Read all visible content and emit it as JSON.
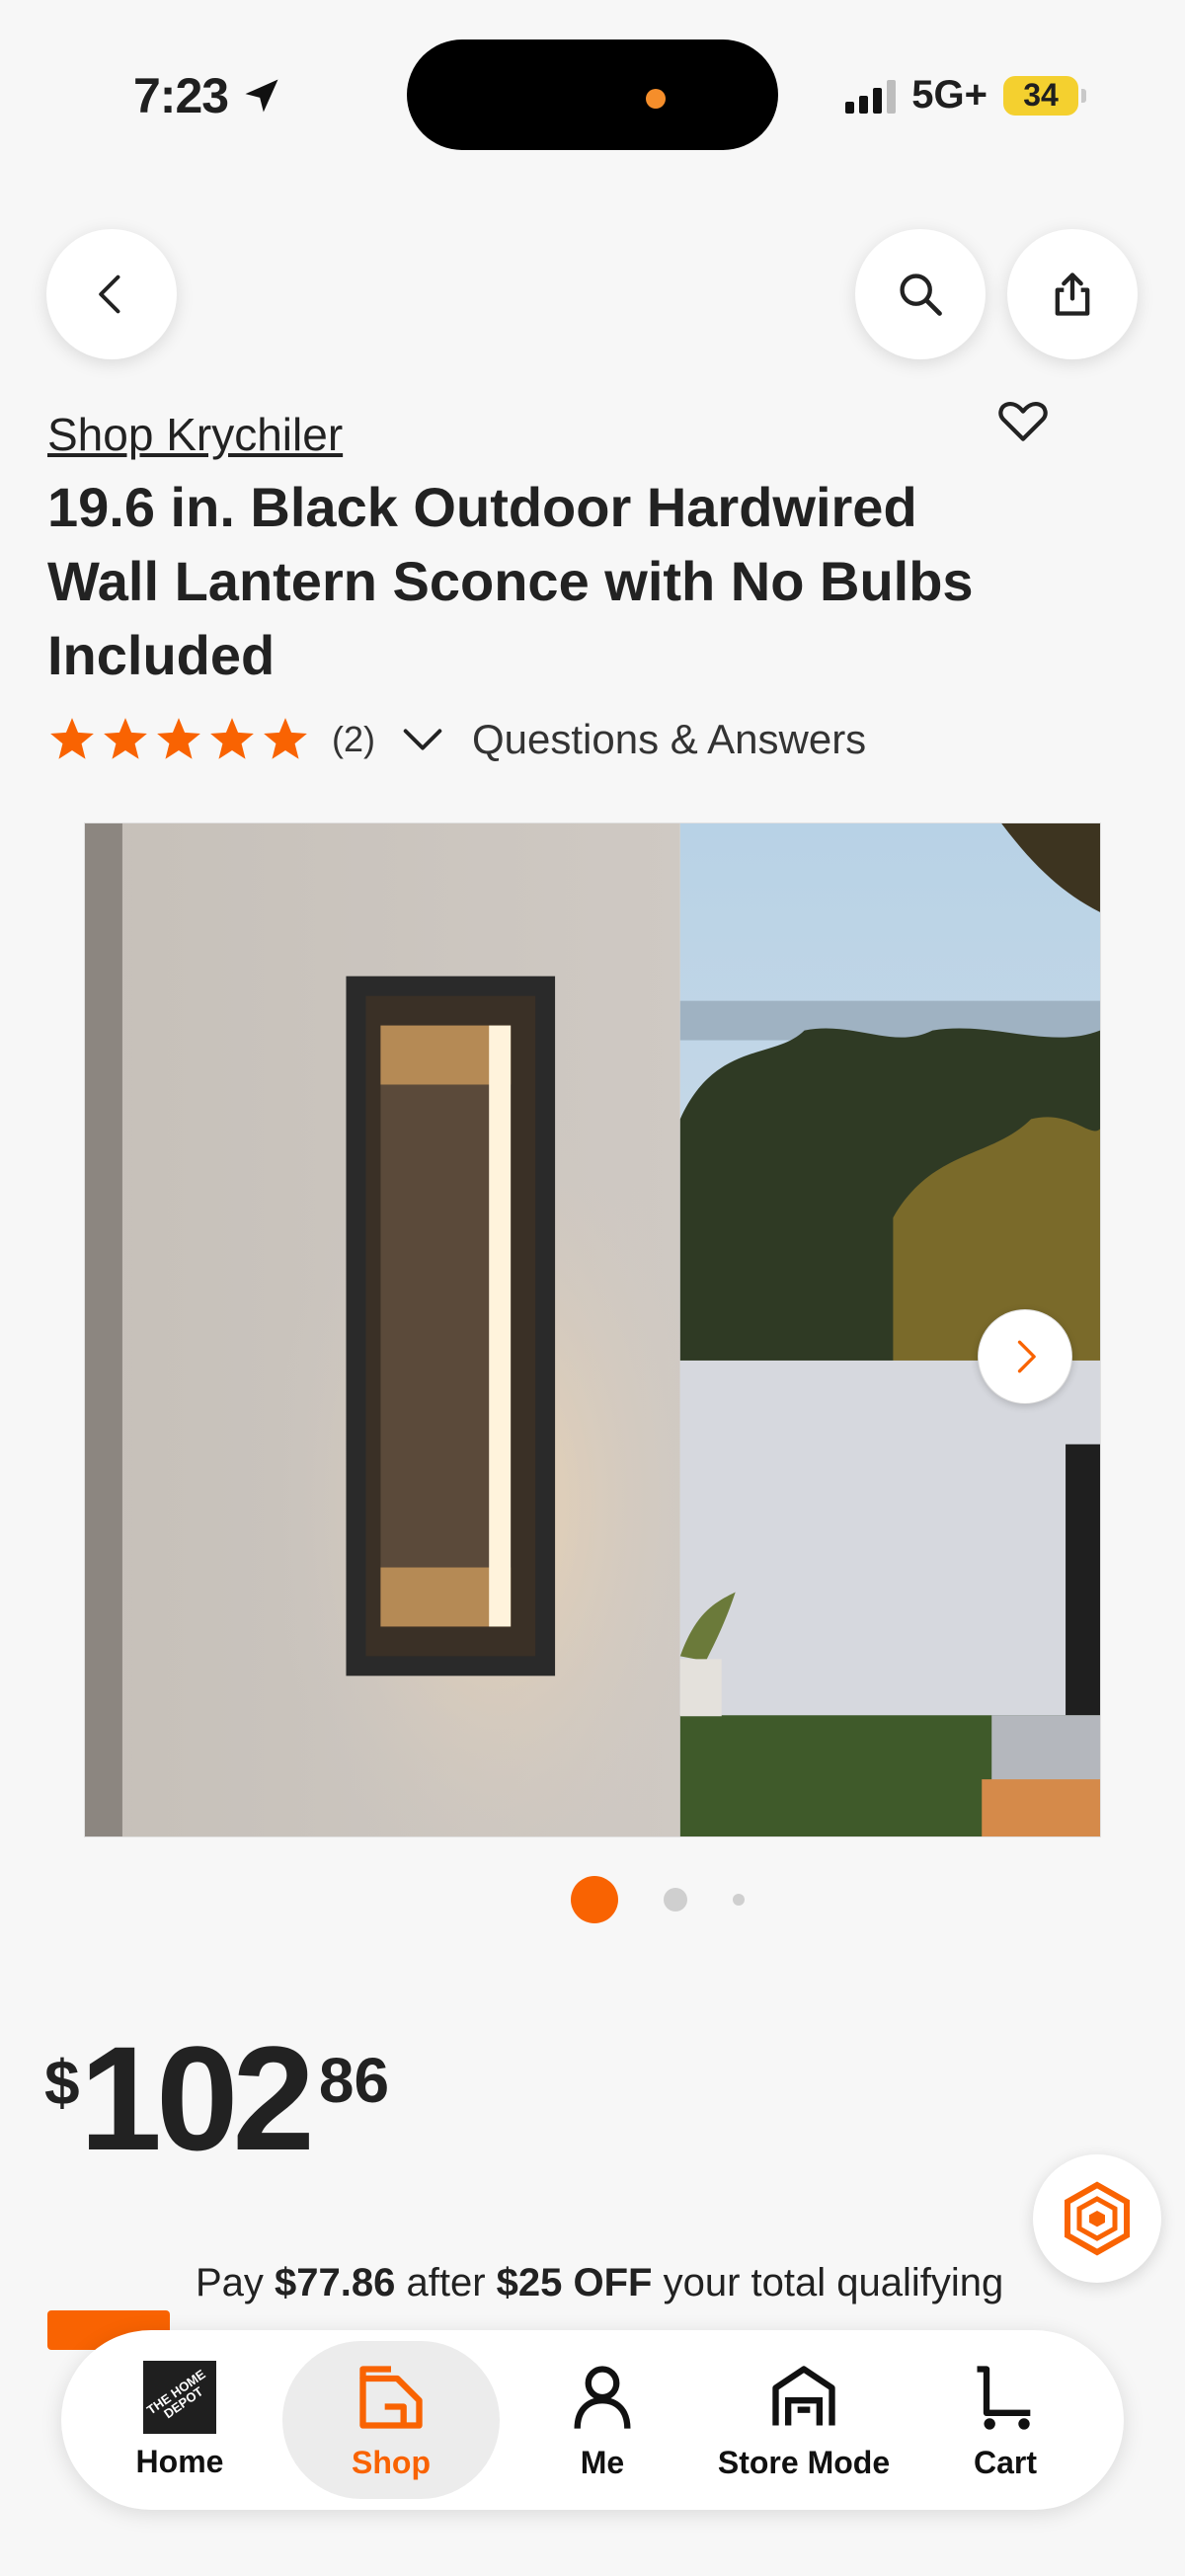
{
  "status_bar": {
    "time": "7:23",
    "network": "5G+",
    "battery": "34"
  },
  "product": {
    "brand_link": "Shop Krychiler",
    "title": "19.6 in. Black Outdoor Hardwired Wall Lantern Sconce with No Bulbs Included",
    "rating": {
      "stars": 5,
      "review_count": "(2)"
    },
    "qa_label": "Questions & Answers",
    "gallery": {
      "current": 1,
      "total": 3
    },
    "price": {
      "currency": "$",
      "whole": "102",
      "cents": "86"
    }
  },
  "promo": {
    "prefix": "Pay ",
    "amount": "$77.86",
    "middle": " after ",
    "discount": "$25 OFF",
    "suffix": " your total qualifying"
  },
  "tabbar": {
    "home": "Home",
    "shop": "Shop",
    "me": "Me",
    "store_mode": "Store Mode",
    "cart": "Cart",
    "home_logo_text": "THE HOME DEPOT"
  },
  "colors": {
    "accent": "#f96302",
    "star": "#f96302",
    "battery": "#f4d02f"
  },
  "icons": [
    "location-arrow-icon",
    "back-chevron-icon",
    "search-icon",
    "share-icon",
    "heart-icon",
    "star-icon",
    "chevron-down-icon",
    "chevron-right-icon",
    "chat-hex-icon",
    "home-depot-logo",
    "shop-bag-icon",
    "person-icon",
    "store-icon",
    "cart-icon"
  ]
}
